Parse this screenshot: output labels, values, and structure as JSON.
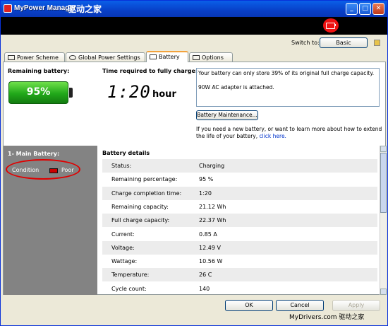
{
  "window": {
    "title": "MyPower Manager",
    "watermark": "驱动之家",
    "controls": {
      "minimize": "_",
      "maximize": "□",
      "close": "✕"
    }
  },
  "header": {
    "switch_label": "Switch to:",
    "switch_button": "Basic"
  },
  "tabs": [
    {
      "label": "Power Scheme"
    },
    {
      "label": "Global Power Settings"
    },
    {
      "label": "Battery"
    },
    {
      "label": "Options"
    }
  ],
  "battery": {
    "remaining_label": "Remaining battery:",
    "remaining_percent": "95%",
    "time_label": "Time required to fully charge:",
    "time_value": "1:20",
    "time_unit": "hour",
    "messages": [
      "Your battery can only store 39% of its original full charge capacity.",
      "90W AC adapter is attached."
    ],
    "maintenance_button": "Battery Maintenance...",
    "learn_text": "If you need a new battery, or want to learn more about how to extend the life of your battery,",
    "learn_link": "click here."
  },
  "sidebar": {
    "title": "1- Main Battery:",
    "condition_label": "Condition",
    "condition_value": "Poor"
  },
  "details": {
    "title": "Battery details",
    "rows": [
      {
        "key": "Status:",
        "value": "Charging"
      },
      {
        "key": "Remaining percentage:",
        "value": "95 %"
      },
      {
        "key": "Charge completion time:",
        "value": "1:20"
      },
      {
        "key": "Remaining capacity:",
        "value": "21.12 Wh"
      },
      {
        "key": "Full charge capacity:",
        "value": "22.37 Wh"
      },
      {
        "key": "Current:",
        "value": "0.85 A"
      },
      {
        "key": "Voltage:",
        "value": "12.49 V"
      },
      {
        "key": "Wattage:",
        "value": "10.56 W"
      },
      {
        "key": "Temperature:",
        "value": "26 C"
      },
      {
        "key": "Cycle count:",
        "value": "140"
      }
    ]
  },
  "buttons": {
    "ok": "OK",
    "cancel": "Cancel",
    "apply": "Apply"
  },
  "footer": {
    "watermark": "MyDrivers.com 驱动之家"
  },
  "colors": {
    "banner": "#000000",
    "battery_green": "#21a81a",
    "alert_red": "#e00000",
    "sidebar_gray": "#838383"
  }
}
